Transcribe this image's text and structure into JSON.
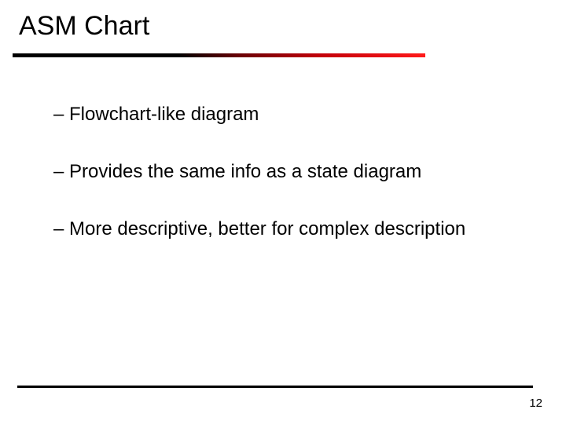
{
  "title": "ASM Chart",
  "bullets": [
    "– Flowchart-like diagram",
    "– Provides the same info as a state diagram",
    "– More descriptive, better for complex description"
  ],
  "page_number": "12"
}
